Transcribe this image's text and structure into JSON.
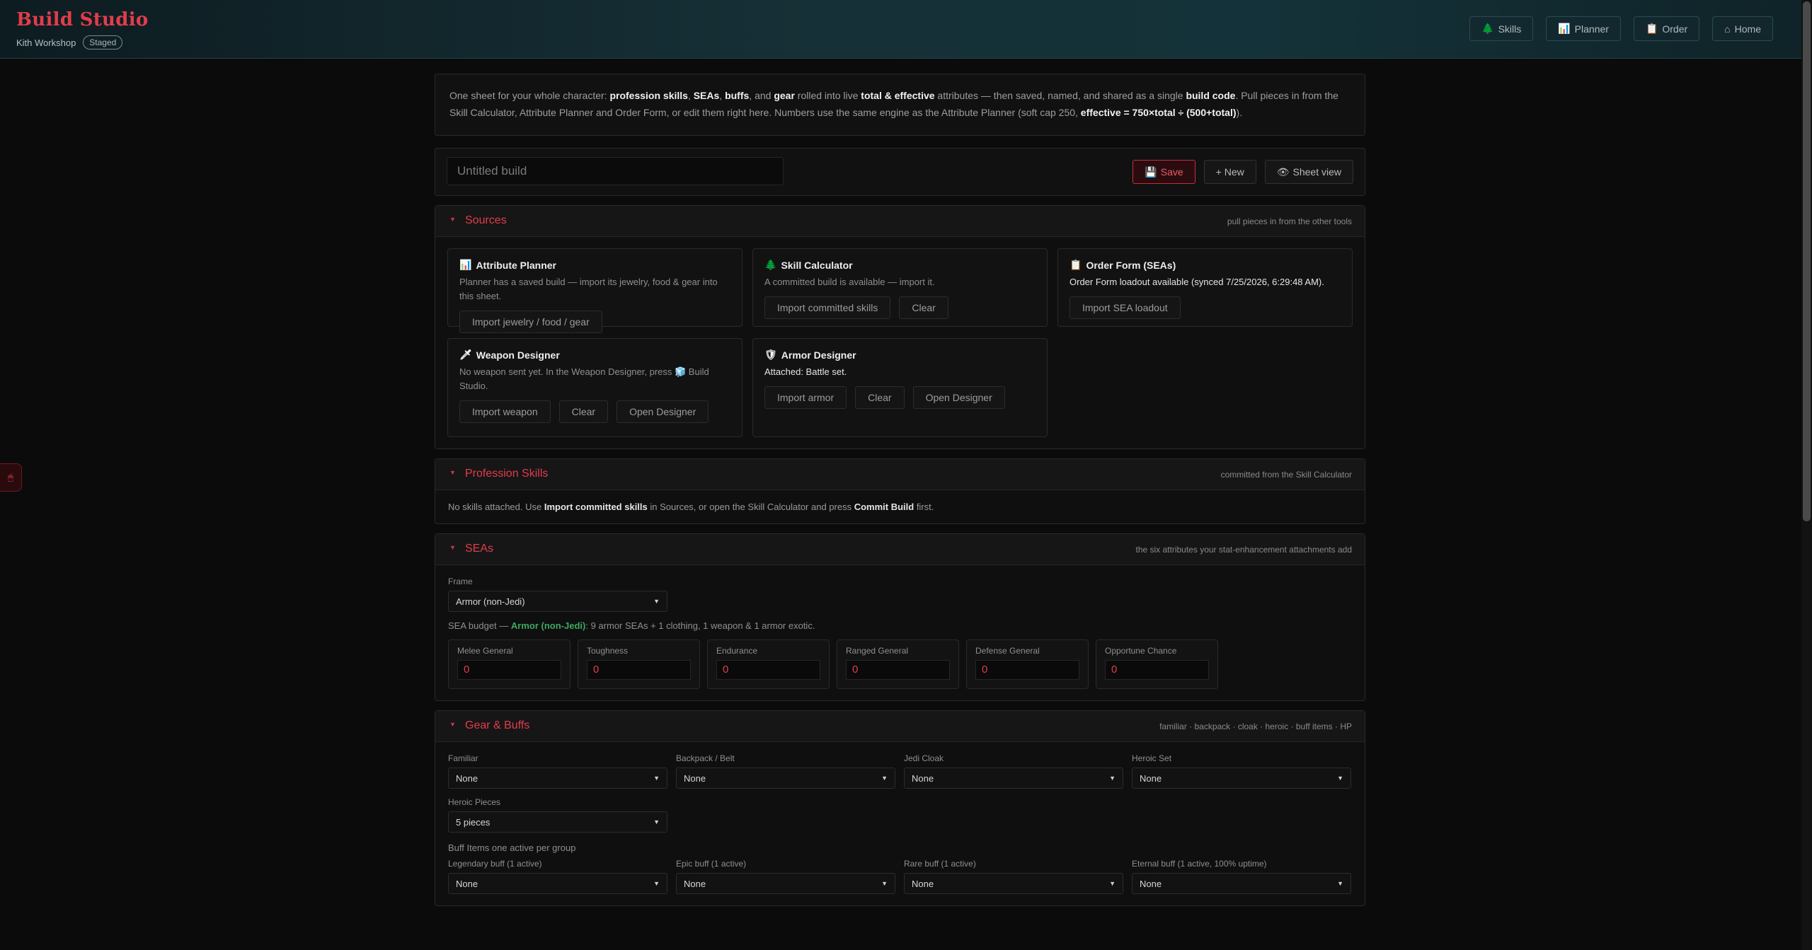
{
  "header": {
    "title": "Build Studio",
    "subtitle": "Kith Workshop",
    "badge": "Staged",
    "nav": [
      {
        "icon": "🌲",
        "label": "Skills"
      },
      {
        "icon": "📊",
        "label": "Planner"
      },
      {
        "icon": "📋",
        "label": "Order"
      },
      {
        "icon": "⌂",
        "label": "Home"
      }
    ]
  },
  "side_tab_icon": "🖱",
  "intro": {
    "p1": "One sheet for your whole character: ",
    "b1": "profession skills",
    "p2": ", ",
    "b2": "SEAs",
    "p3": ", ",
    "b3": "buffs",
    "p4": ", and ",
    "b4": "gear",
    "p5": " rolled into live ",
    "b5": "total & effective",
    "p6": " attributes — then saved, named, and shared as a single ",
    "b6": "build code",
    "p7": ". Pull pieces in from the Skill Calculator, Attribute Planner and Order Form, or edit them right here. Numbers use the same engine as the Attribute Planner (soft cap 250, ",
    "b7": "effective = 750×total ÷ (500+total)",
    "p8": ")."
  },
  "build": {
    "name_placeholder": "Untitled build",
    "save_icon": "💾",
    "save_label": "Save",
    "new_label": "+ New",
    "sheet_icon": "👁",
    "sheet_label": "Sheet view"
  },
  "sources": {
    "title": "Sources",
    "hint": "pull pieces in from the other tools",
    "cards": [
      {
        "icon": "📊",
        "title": "Attribute Planner",
        "desc": "Planner has a saved build — import its jewelry, food & gear into this sheet.",
        "buttons": [
          "Import jewelry / food / gear"
        ]
      },
      {
        "icon": "🌲",
        "title": "Skill Calculator",
        "desc": "A committed build is available — import it.",
        "buttons": [
          "Import committed skills",
          "Clear"
        ]
      },
      {
        "icon": "📋",
        "title": "Order Form (SEAs)",
        "desc": "Order Form loadout available (synced 7/25/2026, 6:29:48 AM).",
        "buttons": [
          "Import SEA loadout"
        ]
      },
      {
        "icon": "🗡",
        "title": "Weapon Designer",
        "desc_a": "No weapon sent yet. In the Weapon Designer, press ",
        "desc_icon": "🧊",
        "desc_b": " Build Studio.",
        "buttons": [
          "Import weapon",
          "Clear",
          "Open Designer"
        ]
      },
      {
        "icon": "🛡",
        "title": "Armor Designer",
        "desc": "Attached: Battle set.",
        "buttons": [
          "Import armor",
          "Clear",
          "Open Designer"
        ]
      }
    ]
  },
  "profession": {
    "title": "Profession Skills",
    "hint": "committed from the Skill Calculator",
    "t1": "No skills attached. Use ",
    "b1": "Import committed skills",
    "t2": " in Sources, or open the Skill Calculator and press ",
    "b2": "Commit Build",
    "t3": " first."
  },
  "seas": {
    "title": "SEAs",
    "hint": "the six attributes your stat-enhancement attachments add",
    "frame_label": "Frame",
    "frame_value": "Armor (non-Jedi)",
    "budget_prefix": "SEA budget — ",
    "budget_frame": "Armor (non-Jedi)",
    "budget_suffix": ": 9 armor SEAs + 1 clothing, 1 weapon & 1 armor exotic.",
    "attributes": [
      {
        "label": "Melee General",
        "value": "0"
      },
      {
        "label": "Toughness",
        "value": "0"
      },
      {
        "label": "Endurance",
        "value": "0"
      },
      {
        "label": "Ranged General",
        "value": "0"
      },
      {
        "label": "Defense General",
        "value": "0"
      },
      {
        "label": "Opportune Chance",
        "value": "0"
      }
    ]
  },
  "gear": {
    "title": "Gear & Buffs",
    "hint": "familiar · backpack · cloak · heroic · buff items · HP",
    "fields": [
      {
        "label": "Familiar",
        "value": "None"
      },
      {
        "label": "Backpack / Belt",
        "value": "None"
      },
      {
        "label": "Jedi Cloak",
        "value": "None"
      },
      {
        "label": "Heroic Set",
        "value": "None"
      }
    ],
    "heroic_pieces_label": "Heroic Pieces",
    "heroic_pieces_value": "5 pieces",
    "buff_note": "Buff Items one active per group",
    "buffs": [
      {
        "label": "Legendary buff (1 active)",
        "value": "None"
      },
      {
        "label": "Epic buff (1 active)",
        "value": "None"
      },
      {
        "label": "Rare buff (1 active)",
        "value": "None"
      },
      {
        "label": "Eternal buff (1 active, 100% uptime)",
        "value": "None"
      }
    ]
  },
  "colors": {
    "accent": "#e23c4c",
    "green": "#3fa85f",
    "background": "#0b0b0b"
  }
}
